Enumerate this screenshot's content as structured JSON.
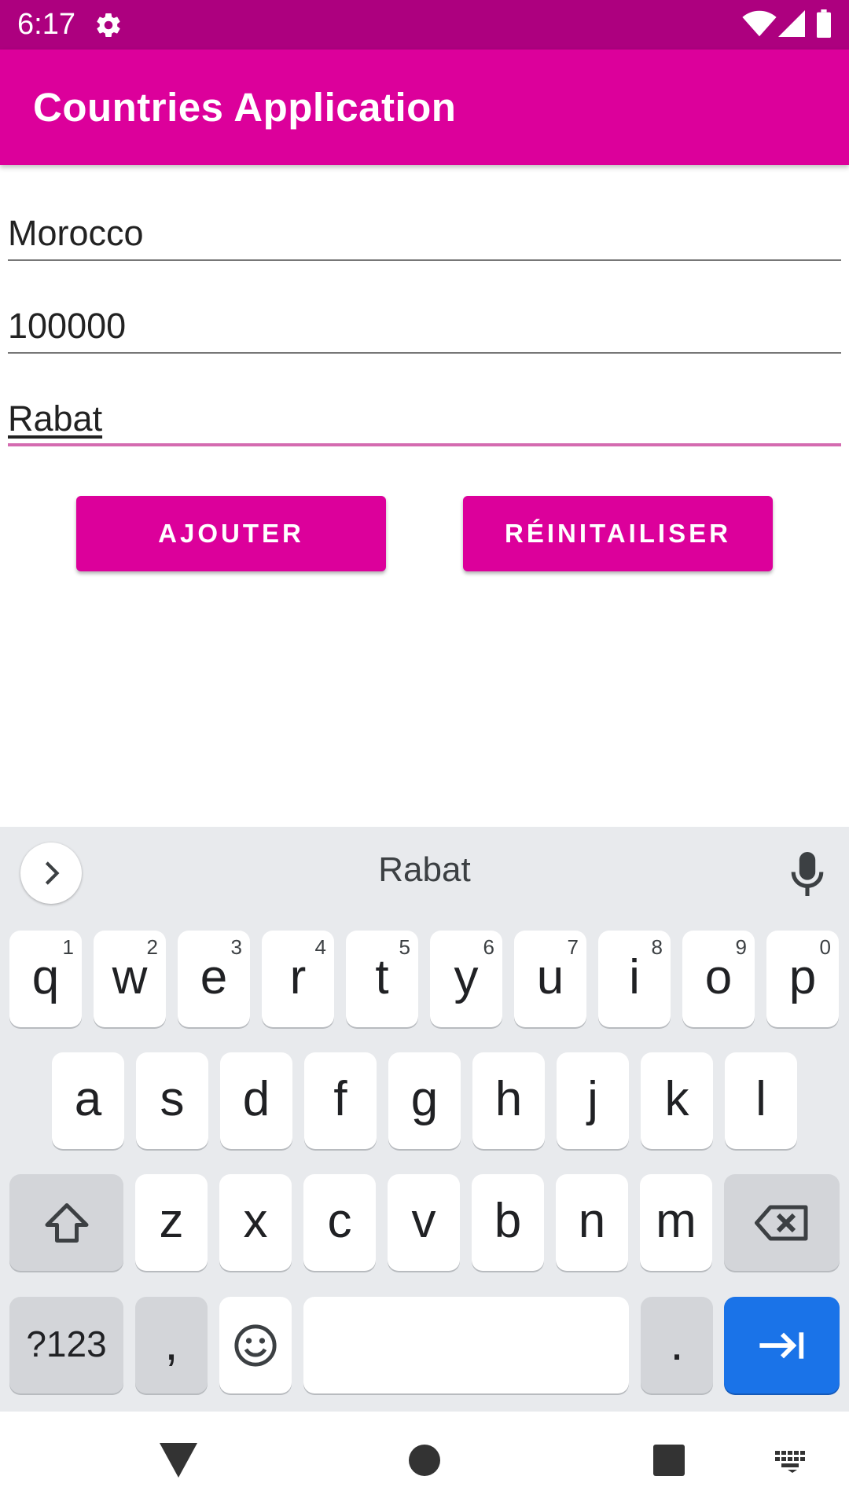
{
  "status_bar": {
    "time": "6:17"
  },
  "app_bar": {
    "title": "Countries Application"
  },
  "form": {
    "country_value": "Morocco",
    "population_value": "100000",
    "capital_value": "Rabat"
  },
  "buttons": {
    "add_label": "AJOUTER",
    "reset_label": "RÉINITAILISER"
  },
  "keyboard": {
    "suggestion": "Rabat",
    "row1": [
      {
        "key": "q",
        "hint": "1"
      },
      {
        "key": "w",
        "hint": "2"
      },
      {
        "key": "e",
        "hint": "3"
      },
      {
        "key": "r",
        "hint": "4"
      },
      {
        "key": "t",
        "hint": "5"
      },
      {
        "key": "y",
        "hint": "6"
      },
      {
        "key": "u",
        "hint": "7"
      },
      {
        "key": "i",
        "hint": "8"
      },
      {
        "key": "o",
        "hint": "9"
      },
      {
        "key": "p",
        "hint": "0"
      }
    ],
    "row2": [
      "a",
      "s",
      "d",
      "f",
      "g",
      "h",
      "j",
      "k",
      "l"
    ],
    "row3": [
      "z",
      "x",
      "c",
      "v",
      "b",
      "n",
      "m"
    ],
    "symbols_label": "?123",
    "comma_label": ",",
    "period_label": "."
  },
  "colors": {
    "status_bar": "#ad007f",
    "primary": "#dc009b",
    "field_focus_line": "#d46bb0",
    "keyboard_bg": "#e8eaed",
    "enter_key": "#1a73e8"
  },
  "icons": {
    "status": [
      "gear-icon",
      "wifi-icon",
      "signal-icon",
      "battery-icon"
    ],
    "keyboard": [
      "chevron-right-icon",
      "mic-icon",
      "shift-icon",
      "backspace-icon",
      "emoji-icon",
      "tab-enter-icon"
    ],
    "nav": [
      "back-icon",
      "home-icon",
      "recents-icon",
      "keyboard-switch-icon"
    ]
  }
}
